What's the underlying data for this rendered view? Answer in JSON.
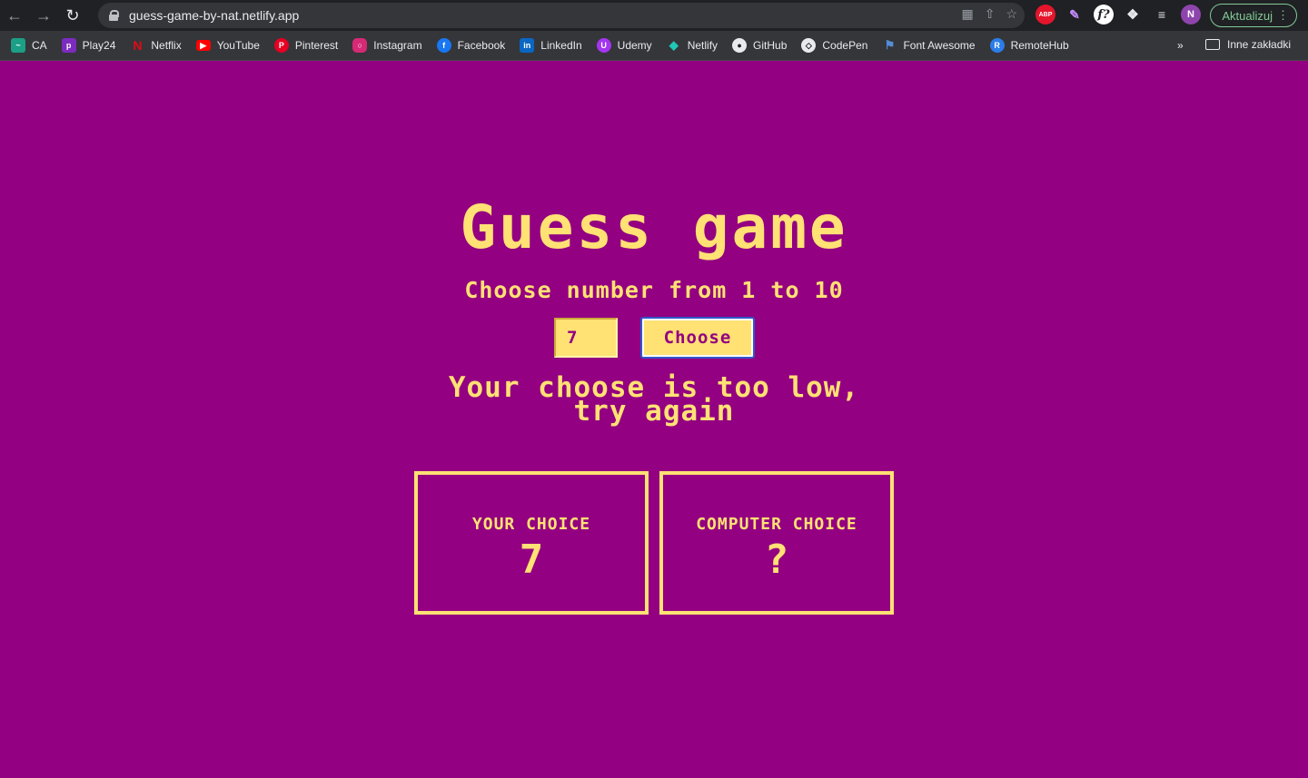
{
  "browser": {
    "url": "guess-game-by-nat.netlify.app",
    "update_label": "Aktualizuj",
    "avatar_initial": "N",
    "abp_label": "ABP",
    "ff_label": "f?",
    "bookmarks": [
      {
        "label": "CA",
        "icon": "ca-icon",
        "color": "#1b9f86"
      },
      {
        "label": "Play24",
        "icon": "play24-icon",
        "color": "#7b2cbf"
      },
      {
        "label": "Netflix",
        "icon": "netflix-icon",
        "color": "#e50914"
      },
      {
        "label": "YouTube",
        "icon": "youtube-icon",
        "color": "#ff0000"
      },
      {
        "label": "Pinterest",
        "icon": "pinterest-icon",
        "color": "#e60023"
      },
      {
        "label": "Instagram",
        "icon": "instagram-icon",
        "color": "#d62976"
      },
      {
        "label": "Facebook",
        "icon": "facebook-icon",
        "color": "#1877f2"
      },
      {
        "label": "LinkedIn",
        "icon": "linkedin-icon",
        "color": "#0a66c2"
      },
      {
        "label": "Udemy",
        "icon": "udemy-icon",
        "color": "#a435f0"
      },
      {
        "label": "Netlify",
        "icon": "netlify-icon",
        "color": "#20c6b7"
      },
      {
        "label": "GitHub",
        "icon": "github-icon",
        "color": "#24292f"
      },
      {
        "label": "CodePen",
        "icon": "codepen-icon",
        "color": "#111111"
      },
      {
        "label": "Font Awesome",
        "icon": "font-awesome-icon",
        "color": "#538dd7"
      },
      {
        "label": "RemoteHub",
        "icon": "remotehub-icon",
        "color": "#2b7de9"
      }
    ],
    "more_label": "»",
    "other_bookmarks": "Inne zakładki"
  },
  "game": {
    "title": "Guess game",
    "subtitle": "Choose number from 1 to 10",
    "input_value": "7",
    "button_label": "Choose",
    "message_line1": "Your choose is too low,",
    "message_line2": "try again",
    "your_choice_label": "YOUR CHOICE",
    "your_choice_value": "7",
    "computer_choice_label": "COMPUTER CHOICE",
    "computer_choice_value": "?"
  },
  "colors": {
    "background": "#930081",
    "accent": "#ffe174"
  }
}
